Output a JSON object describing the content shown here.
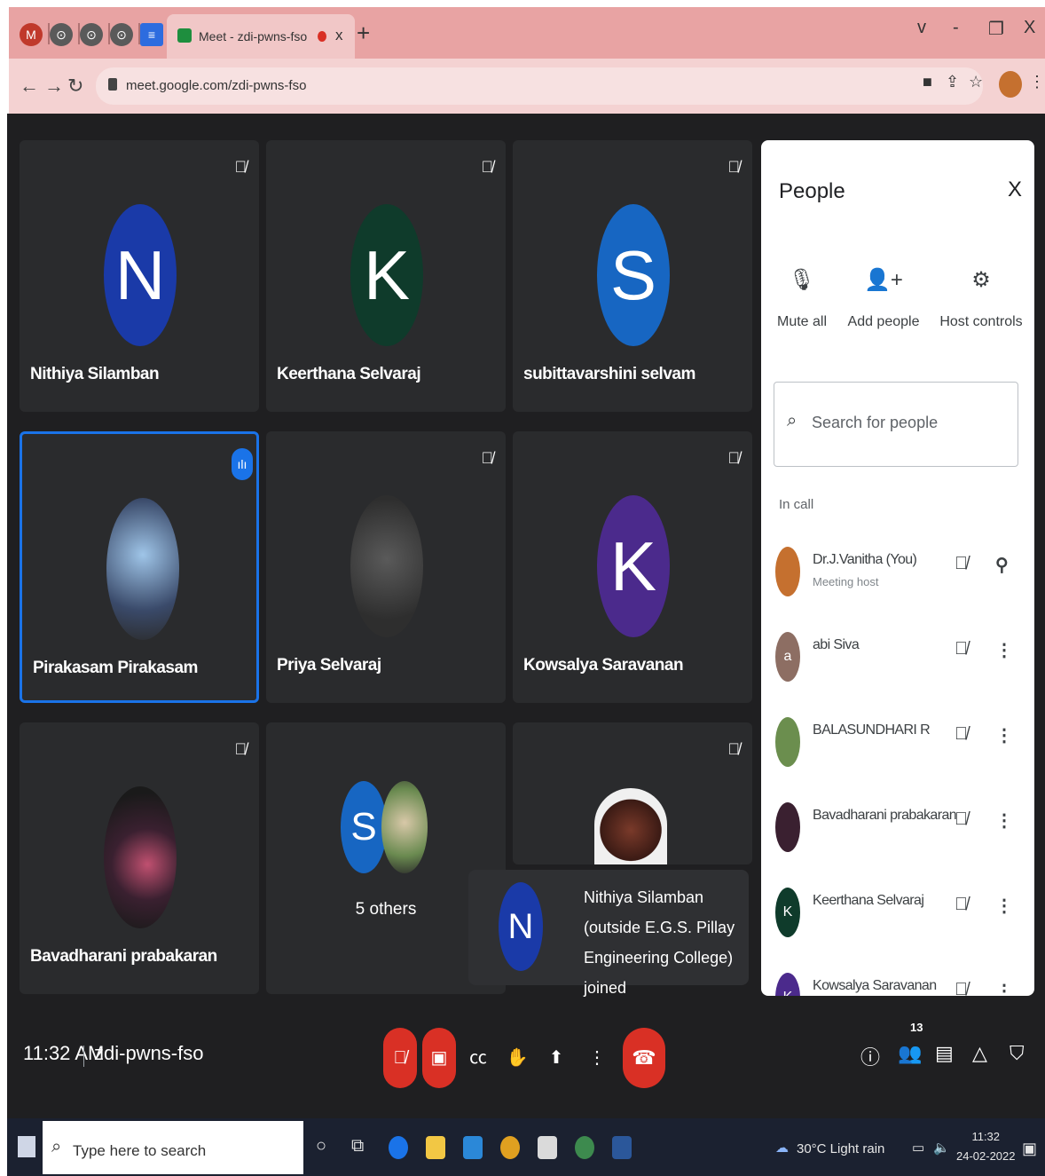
{
  "browser": {
    "tab_title": "Meet - zdi-pwns-fso",
    "tab_close": "x",
    "new_tab": "+",
    "window_controls": {
      "menu": "v",
      "minimize": "-",
      "maximize": "❐",
      "close": "X"
    },
    "url": "meet.google.com/zdi-pwns-fso"
  },
  "tiles": [
    {
      "name": "Nithiya Silamban",
      "initial": "N",
      "color": "#1a3aa8"
    },
    {
      "name": "Keerthana Selvaraj",
      "initial": "K",
      "color": "#0f3b2b"
    },
    {
      "name": "subittavarshini selvam",
      "initial": "S",
      "color": "#1766c2"
    },
    {
      "name": "Pirakasam Pirakasam",
      "initial": "",
      "color": "#3a4a6a"
    },
    {
      "name": "Priya Selvaraj",
      "initial": "",
      "color": "#2e2e2e"
    },
    {
      "name": "Kowsalya Saravanan",
      "initial": "K",
      "color": "#4b2a8c"
    },
    {
      "name": "Bavadharani prabakaran",
      "initial": "",
      "color": "#3a2030"
    },
    {
      "name": "5 others",
      "initial": "S",
      "color": "#1766c2"
    }
  ],
  "notification": {
    "initial": "N",
    "text": "Nithiya Silamban (outside E.G.S. Pillay Engineering College) joined"
  },
  "people_panel": {
    "title": "People",
    "close": "X",
    "actions": [
      {
        "label": "Mute all",
        "icon": "🎙"
      },
      {
        "label": "Add people",
        "icon": "👤+"
      },
      {
        "label": "Host controls",
        "icon": "⚙"
      }
    ],
    "search_placeholder": "Search for people",
    "section_label": "In call",
    "participants": [
      {
        "name": "Dr.J.Vanitha (You)",
        "subtitle": "Meeting host",
        "initial": "",
        "color": "#c5702f"
      },
      {
        "name": "abi Siva",
        "subtitle": "",
        "initial": "a",
        "color": "#8d6e63"
      },
      {
        "name": "BALASUNDHARI R",
        "subtitle": "",
        "initial": "",
        "color": "#6b8e4e"
      },
      {
        "name": "Bavadharani prabakaran",
        "subtitle": "",
        "initial": "",
        "color": "#3a2030"
      },
      {
        "name": "Keerthana Selvaraj",
        "subtitle": "",
        "initial": "K",
        "color": "#0f3b2b"
      },
      {
        "name": "Kowsalya Saravanan",
        "subtitle": "",
        "initial": "K",
        "color": "#4b2a8c"
      }
    ]
  },
  "meeting": {
    "time": "11:32 AM",
    "code": "zdi-pwns-fso",
    "participant_count": "13"
  },
  "taskbar": {
    "search_placeholder": "Type here to search",
    "weather": "30°C  Light rain",
    "clock_time": "11:32",
    "clock_date": "24-02-2022"
  }
}
